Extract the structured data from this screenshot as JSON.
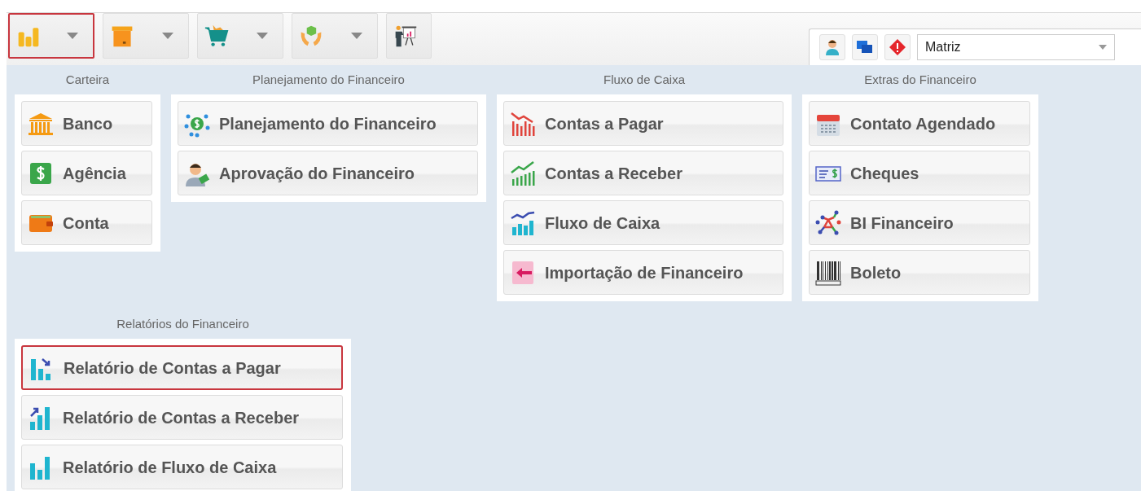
{
  "toolbar": {
    "buttons": [
      {
        "has_menu": true,
        "selected": true
      },
      {
        "has_menu": true,
        "selected": false
      },
      {
        "has_menu": true,
        "selected": false
      },
      {
        "has_menu": true,
        "selected": false
      },
      {
        "has_menu": false,
        "selected": false
      }
    ],
    "company_select": {
      "value": "Matriz"
    }
  },
  "groups": [
    {
      "title": "Carteira",
      "items": [
        {
          "label": "Banco",
          "selected": false
        },
        {
          "label": "Agência",
          "selected": false
        },
        {
          "label": "Conta",
          "selected": false
        }
      ]
    },
    {
      "title": "Planejamento do Financeiro",
      "items": [
        {
          "label": "Planejamento do Financeiro",
          "selected": false
        },
        {
          "label": "Aprovação do Financeiro",
          "selected": false
        }
      ]
    },
    {
      "title": "Fluxo de Caixa",
      "items": [
        {
          "label": "Contas a Pagar",
          "selected": false
        },
        {
          "label": "Contas a Receber",
          "selected": false
        },
        {
          "label": "Fluxo de Caixa",
          "selected": false
        },
        {
          "label": "Importação de Financeiro",
          "selected": false
        }
      ]
    },
    {
      "title": "Extras do Financeiro",
      "items": [
        {
          "label": "Contato Agendado",
          "selected": false
        },
        {
          "label": "Cheques",
          "selected": false
        },
        {
          "label": "BI Financeiro",
          "selected": false
        },
        {
          "label": "Boleto",
          "selected": false
        }
      ]
    },
    {
      "title": "Relatórios do Financeiro",
      "items": [
        {
          "label": "Relatório de Contas a Pagar",
          "selected": true
        },
        {
          "label": "Relatório de Contas a Receber",
          "selected": false
        },
        {
          "label": "Relatório de Fluxo de Caixa",
          "selected": false
        }
      ]
    }
  ]
}
